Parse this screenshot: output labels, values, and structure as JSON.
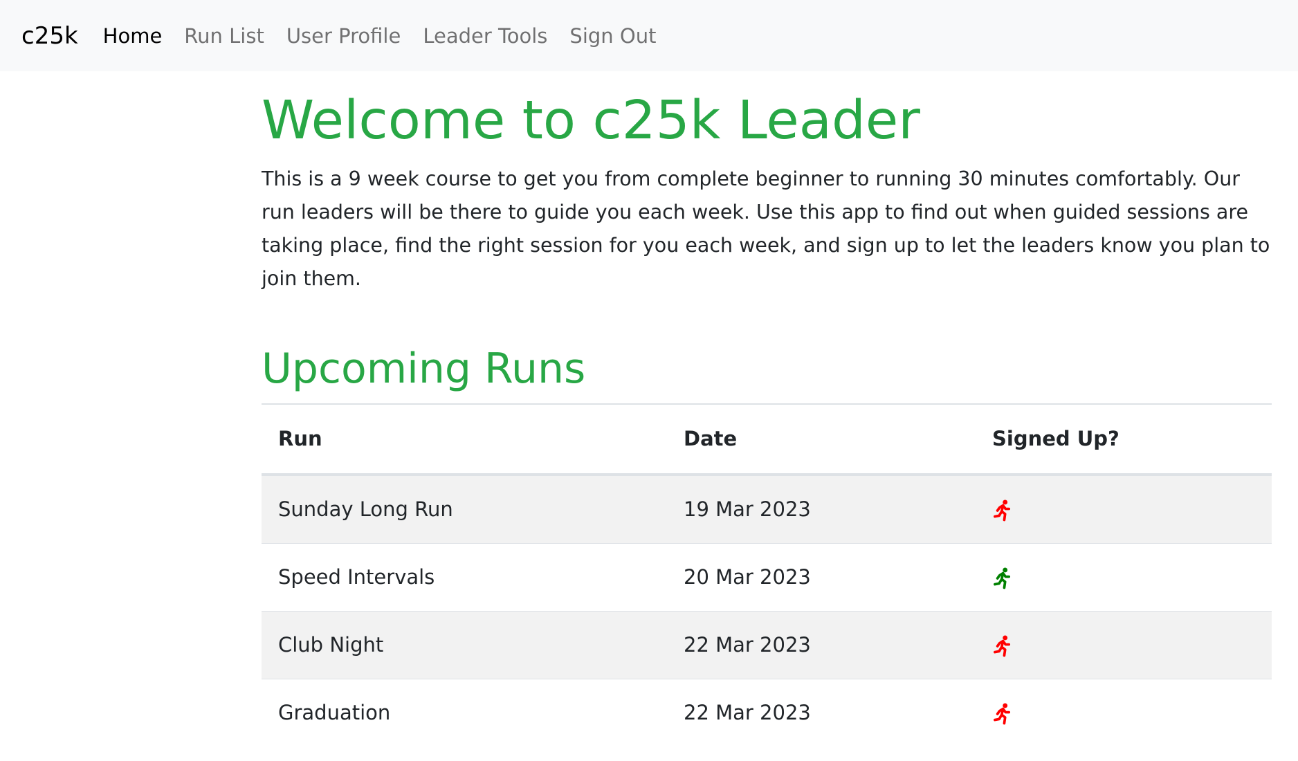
{
  "nav": {
    "brand": "c25k",
    "links": [
      "Home",
      "Run List",
      "User Profile",
      "Leader Tools",
      "Sign Out"
    ]
  },
  "main": {
    "title": "Welcome to c25k Leader",
    "intro": "This is a 9 week course to get you from complete beginner to running 30 minutes comfortably. Our run leaders will be there to guide you each week. Use this app to find out when guided sessions are taking place, find the right session for you each week, and sign up to let the leaders know you plan to join them.",
    "runs_heading": "Upcoming Runs"
  },
  "table": {
    "headers": [
      "Run",
      "Date",
      "Signed Up?"
    ],
    "rows": [
      {
        "run": "Sunday Long Run",
        "date": "19 Mar 2023",
        "signed_up": false,
        "icon": "running-person-icon",
        "icon_color": "#ff0000"
      },
      {
        "run": "Speed Intervals",
        "date": "20 Mar 2023",
        "signed_up": true,
        "icon": "running-person-icon",
        "icon_color": "#008000"
      },
      {
        "run": "Club Night",
        "date": "22 Mar 2023",
        "signed_up": false,
        "icon": "running-person-icon",
        "icon_color": "#ff0000"
      },
      {
        "run": "Graduation",
        "date": "22 Mar 2023",
        "signed_up": false,
        "icon": "running-person-icon",
        "icon_color": "#ff0000"
      }
    ]
  },
  "colors": {
    "accent_green": "#28a745",
    "signed_up": "#008000",
    "not_signed_up": "#ff0000",
    "navbar_bg": "#f8f9fa",
    "stripe_bg": "#f2f2f2"
  }
}
